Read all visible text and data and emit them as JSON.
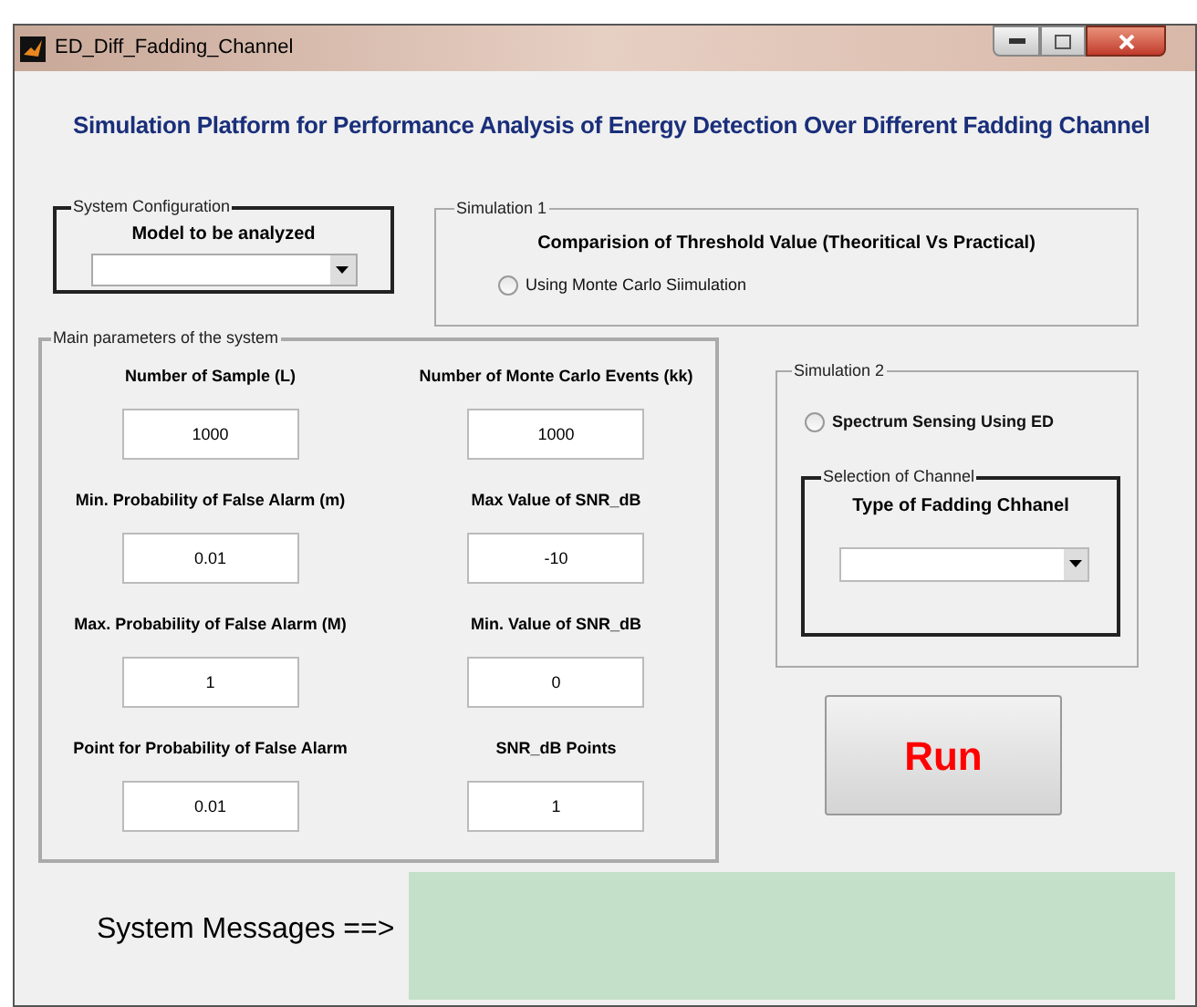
{
  "window": {
    "title": "ED_Diff_Fadding_Channel"
  },
  "heading": "Simulation Platform for Performance Analysis of Energy Detection Over Different Fadding Channel",
  "system_configuration": {
    "title": "System Configuration",
    "label": "Model to be analyzed"
  },
  "simulation_1": {
    "title": "Simulation 1",
    "label": "Comparision of Threshold Value (Theoritical Vs Practical)",
    "option": {
      "label": "Using Monte Carlo Siimulation",
      "selected": false
    }
  },
  "main_parameters": {
    "title": "Main parameters of the system",
    "fields": [
      {
        "label": "Number of Sample (L)",
        "value": "1000"
      },
      {
        "label": "Number of Monte Carlo Events (kk)",
        "value": "1000"
      },
      {
        "label": "Min. Probability of False Alarm (m)",
        "value": "0.01"
      },
      {
        "label": "Max Value of SNR_dB",
        "value": "-10"
      },
      {
        "label": "Max. Probability of False Alarm (M)",
        "value": "1"
      },
      {
        "label": "Min. Value of SNR_dB",
        "value": "0"
      },
      {
        "label": "Point for Probability of False Alarm",
        "value": "0.01"
      },
      {
        "label": "SNR_dB Points",
        "value": "1"
      }
    ]
  },
  "simulation_2": {
    "title": "Simulation 2",
    "option": {
      "label": "Spectrum Sensing Using ED",
      "selected": false
    },
    "channel_selection": {
      "title": "Selection of Channel",
      "label": "Type of Fadding Chhanel"
    }
  },
  "run_button": "Run",
  "system_messages": {
    "label": "System Messages ==>"
  }
}
